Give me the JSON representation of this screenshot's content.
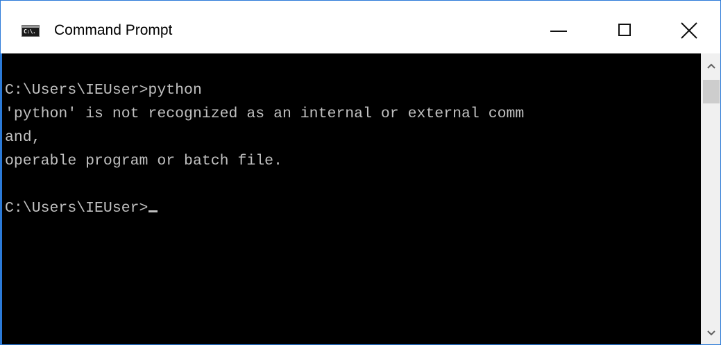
{
  "window": {
    "title": "Command Prompt",
    "icon": "cmd-app-icon",
    "icon_text": "C:\\."
  },
  "controls": {
    "minimize": "minimize-icon",
    "maximize": "maximize-icon",
    "close": "close-icon"
  },
  "console": {
    "background": "#000000",
    "foreground": "#c0c0c0",
    "lines": [
      "",
      "C:\\Users\\IEUser>python",
      "'python' is not recognized as an internal or external comm",
      "and,",
      "operable program or batch file.",
      "",
      "C:\\Users\\IEUser>"
    ]
  },
  "scrollbar": {
    "up_icon": "chevron-up-icon",
    "down_icon": "chevron-down-icon"
  }
}
